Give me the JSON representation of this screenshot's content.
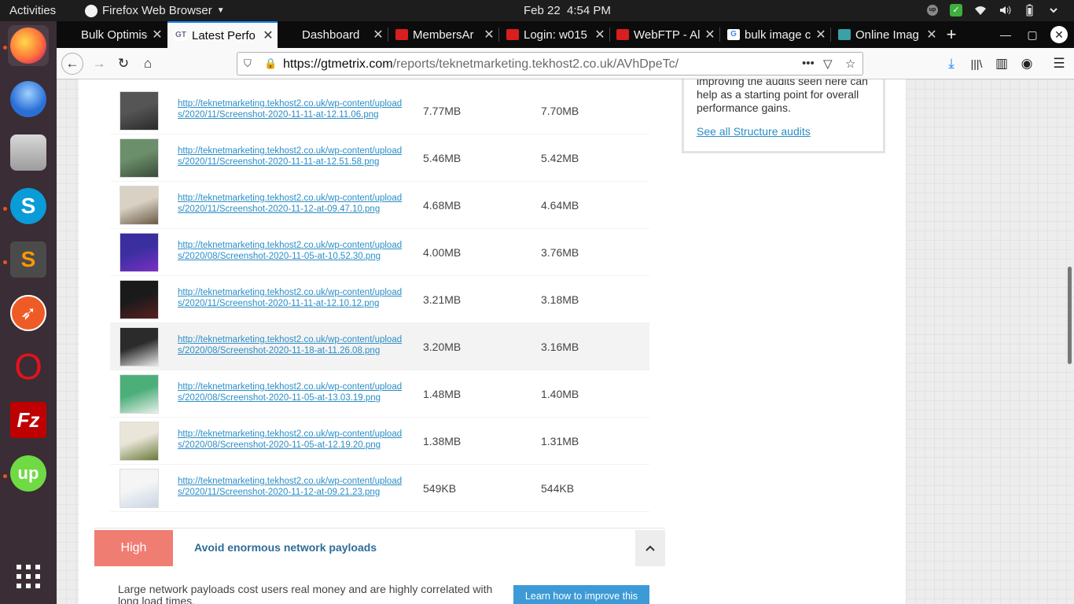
{
  "topbar": {
    "activities": "Activities",
    "app_menu": "Firefox Web Browser",
    "date": "Feb 22",
    "time": "4:54 PM",
    "tray_up_label": "up"
  },
  "dock": [
    {
      "name": "firefox",
      "color": "#ff7139"
    },
    {
      "name": "thunderbird",
      "color": "#2a6fd6"
    },
    {
      "name": "files",
      "color": "#9c9c9c"
    },
    {
      "name": "skype",
      "color": "#0a9bd9",
      "glyph": "S"
    },
    {
      "name": "sublime-text",
      "color": "#4b4b4b",
      "glyph": "S"
    },
    {
      "name": "postman",
      "color": "#ef5b25"
    },
    {
      "name": "opera",
      "color": "#e0131e",
      "glyph": "O"
    },
    {
      "name": "filezilla",
      "color": "#bf0000",
      "glyph": "Fz"
    },
    {
      "name": "upwork",
      "color": "#6fda44",
      "glyph": "up"
    }
  ],
  "tabs": [
    {
      "label": "Bulk Optimise",
      "fav_color": "#0c0c0d",
      "fav_glyph": ""
    },
    {
      "label": "Latest Perfo",
      "fav_color": "#ffffff",
      "fav_glyph": "GT",
      "active": true
    },
    {
      "label": "Dashboard",
      "fav_color": "#0c0c0d",
      "fav_glyph": ""
    },
    {
      "label": "MembersAr",
      "fav_color": "#d81e1e",
      "fav_glyph": ""
    },
    {
      "label": "Login: w015",
      "fav_color": "#d81e1e",
      "fav_glyph": ""
    },
    {
      "label": "WebFTP - Al",
      "fav_color": "#d81e1e",
      "fav_glyph": ""
    },
    {
      "label": "bulk image c",
      "fav_color": "#ffffff",
      "fav_glyph": "G"
    },
    {
      "label": "Online Imag",
      "fav_color": "#3aa1a6",
      "fav_glyph": ""
    }
  ],
  "url": {
    "domain": "https://gtmetrix.com",
    "path": "/reports/teknetmarketing.tekhost2.co.uk/AVhDpeTc/"
  },
  "rows": [
    {
      "url": "http://teknetmarketing.tekhost2.co.uk/wp-content/uploads/2020/11/Screenshot-2020-11-11-at-12.11.06.png",
      "original": "7.77MB",
      "optimized": "7.70MB",
      "thumb": [
        "#555555",
        "#2a2a2a"
      ]
    },
    {
      "url": "http://teknetmarketing.tekhost2.co.uk/wp-content/uploads/2020/11/Screenshot-2020-11-11-at-12.51.58.png",
      "original": "5.46MB",
      "optimized": "5.42MB",
      "thumb": [
        "#6b8f6a",
        "#3a4a3a"
      ]
    },
    {
      "url": "http://teknetmarketing.tekhost2.co.uk/wp-content/uploads/2020/11/Screenshot-2020-11-12-at-09.47.10.png",
      "original": "4.68MB",
      "optimized": "4.64MB",
      "thumb": [
        "#d9d2c4",
        "#6b5a46"
      ]
    },
    {
      "url": "http://teknetmarketing.tekhost2.co.uk/wp-content/uploads/2020/08/Screenshot-2020-11-05-at-10.52.30.png",
      "original": "4.00MB",
      "optimized": "3.76MB",
      "thumb": [
        "#3b2fa0",
        "#7a2fc4"
      ]
    },
    {
      "url": "http://teknetmarketing.tekhost2.co.uk/wp-content/uploads/2020/11/Screenshot-2020-11-11-at-12.10.12.png",
      "original": "3.21MB",
      "optimized": "3.18MB",
      "thumb": [
        "#1a1a1a",
        "#5a2020"
      ]
    },
    {
      "url": "http://teknetmarketing.tekhost2.co.uk/wp-content/uploads/2020/08/Screenshot-2020-11-18-at-11.26.08.png",
      "original": "3.20MB",
      "optimized": "3.16MB",
      "thumb": [
        "#2b2b2b",
        "#e8e8e8"
      ],
      "highlight": true
    },
    {
      "url": "http://teknetmarketing.tekhost2.co.uk/wp-content/uploads/2020/08/Screenshot-2020-11-05-at-13.03.19.png",
      "original": "1.48MB",
      "optimized": "1.40MB",
      "thumb": [
        "#4caf7a",
        "#e6f0e8"
      ]
    },
    {
      "url": "http://teknetmarketing.tekhost2.co.uk/wp-content/uploads/2020/08/Screenshot-2020-11-05-at-12.19.20.png",
      "original": "1.38MB",
      "optimized": "1.31MB",
      "thumb": [
        "#e9e5d8",
        "#6a7a3a"
      ]
    },
    {
      "url": "http://teknetmarketing.tekhost2.co.uk/wp-content/uploads/2020/11/Screenshot-2020-11-12-at-09.21.23.png",
      "original": "549KB",
      "optimized": "544KB",
      "thumb": [
        "#f5f5f5",
        "#c9d6e6"
      ]
    }
  ],
  "aside": {
    "text": "improving the audits seen here can help as a starting point for overall performance gains.",
    "link": "See all Structure audits"
  },
  "audit": {
    "badge": "High",
    "title": "Avoid enormous network payloads",
    "description": "Large network payloads cost users real money and are highly correlated with long load times.",
    "learn_button": "Learn how to improve this"
  }
}
